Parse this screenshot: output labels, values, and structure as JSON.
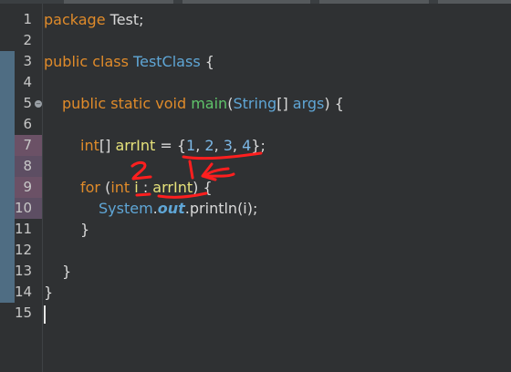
{
  "editor": {
    "line_numbers": [
      "1",
      "2",
      "3",
      "4",
      "5",
      "6",
      "7",
      "8",
      "9",
      "10",
      "11",
      "12",
      "13",
      "14",
      "15"
    ],
    "lines": {
      "l1": [
        "package",
        " Test;"
      ],
      "l3": [
        "public",
        " ",
        "class",
        " ",
        "TestClass",
        " {"
      ],
      "l5": [
        "public",
        " ",
        "static",
        " ",
        "void",
        " ",
        "main",
        "(",
        "String",
        "[] ",
        "args",
        ") {"
      ],
      "l7": [
        "int",
        "[] ",
        "arrInt",
        " = {",
        "1",
        ", ",
        "2",
        ", ",
        "3",
        ", ",
        "4",
        "};"
      ],
      "l9": [
        "for",
        " (",
        "int",
        " ",
        "i",
        " : ",
        "arrInt",
        ") {"
      ],
      "l10": [
        "System",
        ".",
        "out",
        ".println(i);"
      ],
      "l11": [
        "}"
      ],
      "l13": [
        "}"
      ],
      "l14": [
        "}"
      ]
    },
    "fold_icon_symbol": "−"
  },
  "annotations": {
    "label_2": "2",
    "label_1": "1",
    "pen_color": "#ff1f1f"
  },
  "colors": {
    "background": "#2f3133",
    "keyword": "#e08b2a",
    "type": "#5fa6d6",
    "method": "#5fc46a",
    "variable": "#e6e27a",
    "number": "#7cb8e6"
  }
}
